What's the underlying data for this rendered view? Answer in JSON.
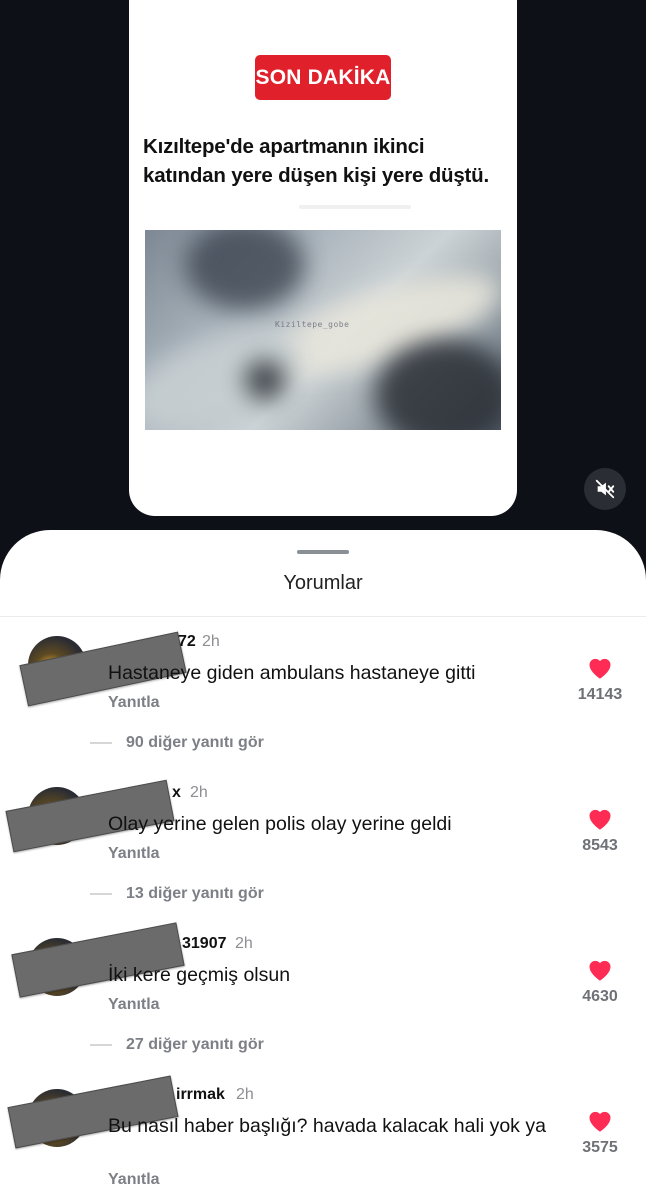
{
  "video": {
    "badge": "SON DAKİKA",
    "headline": "Kızıltepe'de  apartmanın ikinci katından yere düşen kişi yere düştü.",
    "watermark": "Kiziltepe_gobe",
    "mute_icon": "speaker-muted-icon"
  },
  "sheet": {
    "title": "Yorumlar"
  },
  "comments": [
    {
      "username_visible": "72",
      "time": "2h",
      "text": "Hastaneye giden ambulans hastaneye gitti",
      "reply_label": "Yanıtla",
      "likes": "14143",
      "more_replies": "90 diğer yanıtı gör"
    },
    {
      "username_visible": "x",
      "time": "2h",
      "text": "Olay yerine gelen polis olay yerine geldi",
      "reply_label": "Yanıtla",
      "likes": "8543",
      "more_replies": "13 diğer yanıtı gör"
    },
    {
      "username_visible": "31907",
      "time": "2h",
      "text": "İki kere geçmiş olsun",
      "reply_label": "Yanıtla",
      "likes": "4630",
      "more_replies": "27 diğer yanıtı gör"
    },
    {
      "username_visible": "irrmak",
      "time": "2h",
      "text": "Bu nasıl haber başlığı? havada kalacak hali yok ya",
      "reply_label": "Yanıtla",
      "likes": "3575"
    }
  ],
  "colors": {
    "badge": "#e0202a",
    "heart": "#fe2c55",
    "background_dark": "#0d1117"
  }
}
